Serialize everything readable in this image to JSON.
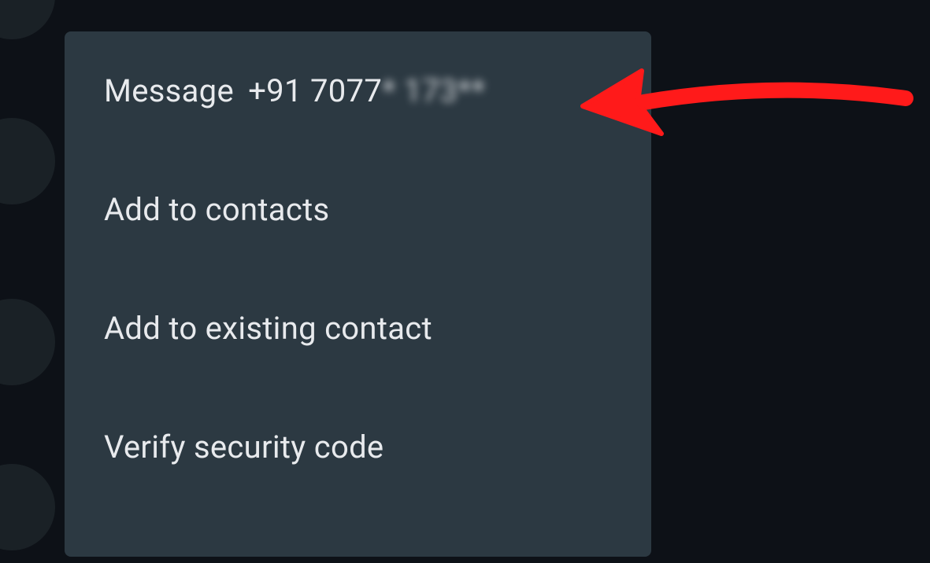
{
  "menu": {
    "items": [
      {
        "label_prefix": "Message",
        "phone_prefix": "+91",
        "phone_visible": "7077",
        "phone_blurred": "* 173**"
      },
      {
        "label": "Add to contacts"
      },
      {
        "label": "Add to existing contact"
      },
      {
        "label": "Verify security code"
      }
    ]
  },
  "annotation": {
    "arrow_color": "#ff1a1a"
  }
}
